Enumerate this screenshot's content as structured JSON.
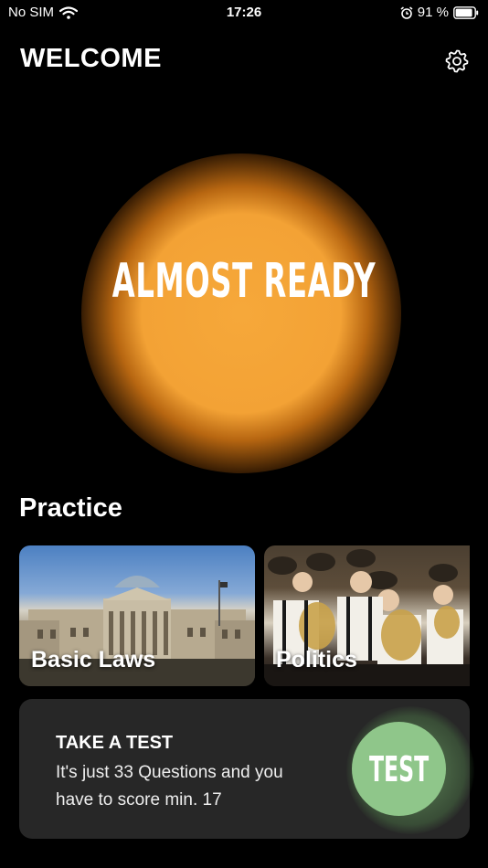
{
  "status_bar": {
    "carrier": "No SIM",
    "time": "17:26",
    "battery_percent": "91 %",
    "battery_level": 0.91
  },
  "header": {
    "title": "WELCOME",
    "settings_icon": "gear-icon"
  },
  "hero": {
    "text": "ALMOST READY",
    "glow_color": "#f3a235"
  },
  "practice": {
    "title": "Practice",
    "cards": [
      {
        "label": "Basic Laws"
      },
      {
        "label": "Politics"
      }
    ]
  },
  "test_card": {
    "heading": "TAKE A TEST",
    "description": "It's just 33 Questions and you have to score min. 17",
    "button_label": "TEST",
    "button_color": "#8fc68a"
  }
}
